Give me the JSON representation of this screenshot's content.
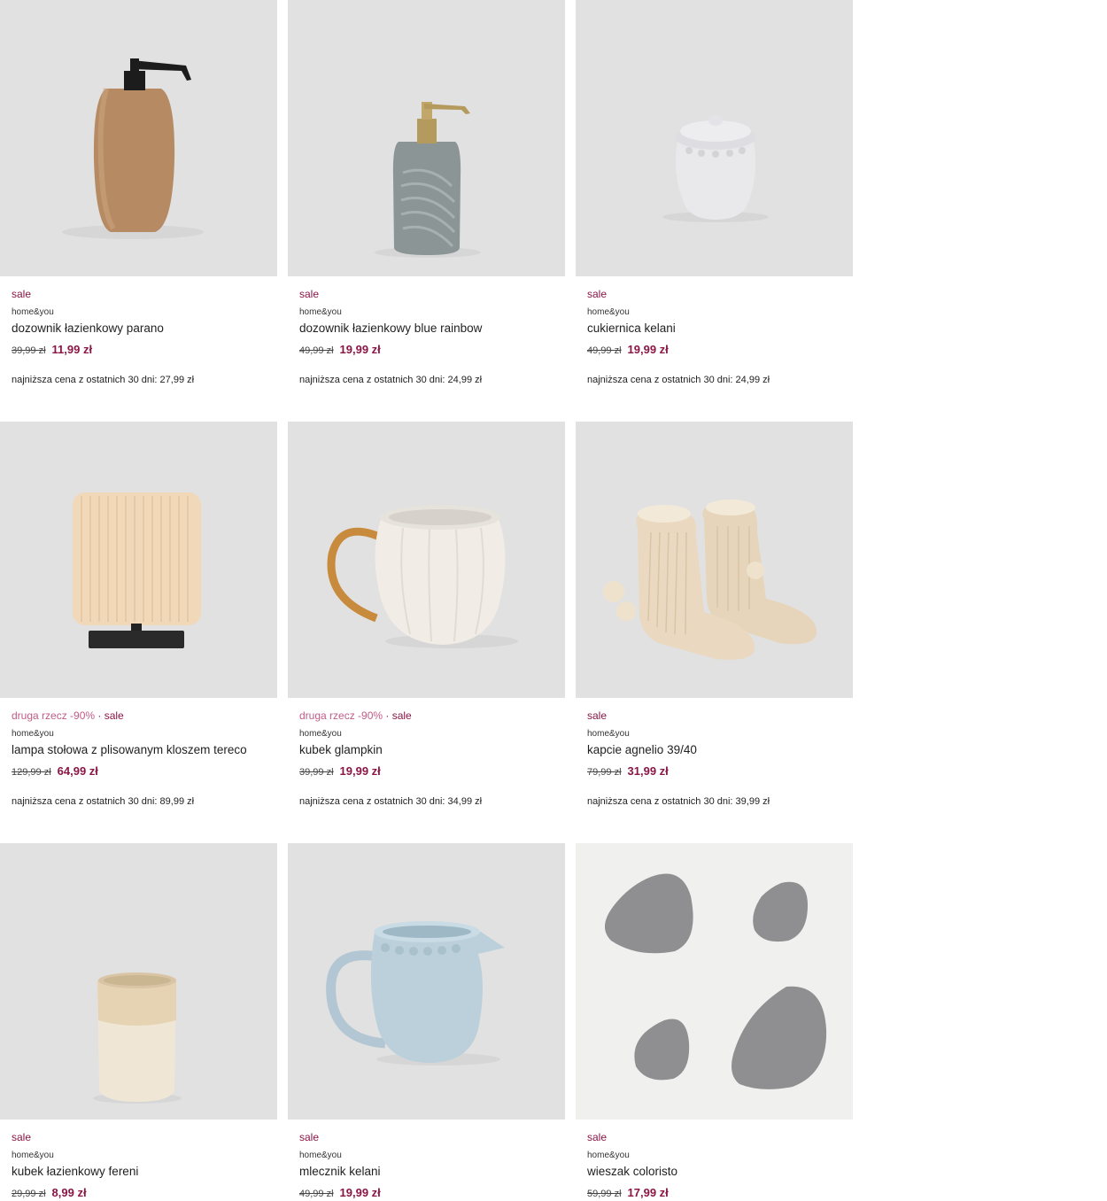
{
  "products": [
    {
      "badge_promo": "",
      "badge_sep": "",
      "badge": "sale",
      "brand": "home&you",
      "title": "dozownik łazienkowy parano",
      "old_price": "39,99 zł",
      "new_price": "11,99 zł",
      "lowest_price": "najniższa cena z ostatnich 30 dni: 27,99 zł"
    },
    {
      "badge_promo": "",
      "badge_sep": "",
      "badge": "sale",
      "brand": "home&you",
      "title": "dozownik łazienkowy blue rainbow",
      "old_price": "49,99 zł",
      "new_price": "19,99 zł",
      "lowest_price": "najniższa cena z ostatnich 30 dni: 24,99 zł"
    },
    {
      "badge_promo": "",
      "badge_sep": "",
      "badge": "sale",
      "brand": "home&you",
      "title": "cukiernica kelani",
      "old_price": "49,99 zł",
      "new_price": "19,99 zł",
      "lowest_price": "najniższa cena z ostatnich 30 dni: 24,99 zł"
    },
    {
      "badge_promo": "druga rzecz -90%",
      "badge_sep": " · ",
      "badge": "sale",
      "brand": "home&you",
      "title": "lampa stołowa z plisowanym kloszem tereco",
      "old_price": "129,99 zł",
      "new_price": "64,99 zł",
      "lowest_price": "najniższa cena z ostatnich 30 dni: 89,99 zł"
    },
    {
      "badge_promo": "druga rzecz -90%",
      "badge_sep": " · ",
      "badge": "sale",
      "brand": "home&you",
      "title": "kubek glampkin",
      "old_price": "39,99 zł",
      "new_price": "19,99 zł",
      "lowest_price": "najniższa cena z ostatnich 30 dni: 34,99 zł"
    },
    {
      "badge_promo": "",
      "badge_sep": "",
      "badge": "sale",
      "brand": "home&you",
      "title": "kapcie agnelio 39/40",
      "old_price": "79,99 zł",
      "new_price": "31,99 zł",
      "lowest_price": "najniższa cena z ostatnich 30 dni: 39,99 zł"
    },
    {
      "badge_promo": "",
      "badge_sep": "",
      "badge": "sale",
      "brand": "home&you",
      "title": "kubek łazienkowy fereni",
      "old_price": "29,99 zł",
      "new_price": "8,99 zł",
      "lowest_price": ""
    },
    {
      "badge_promo": "",
      "badge_sep": "",
      "badge": "sale",
      "brand": "home&you",
      "title": "mlecznik kelani",
      "old_price": "49,99 zł",
      "new_price": "19,99 zł",
      "lowest_price": ""
    },
    {
      "badge_promo": "",
      "badge_sep": "",
      "badge": "sale",
      "brand": "home&you",
      "title": "wieszak coloristo",
      "old_price": "59,99 zł",
      "new_price": "17,99 zł",
      "lowest_price": ""
    }
  ],
  "colors": {
    "sale": "#8a1646",
    "promo": "#c15b86",
    "image_bg": "#e1e1e1"
  },
  "icons": [
    "soap-dispenser-image",
    "soap-dispenser-image",
    "sugar-bowl-image",
    "table-lamp-image",
    "mug-image",
    "slippers-image",
    "bathroom-cup-image",
    "milk-jug-image",
    "wall-hooks-image"
  ]
}
